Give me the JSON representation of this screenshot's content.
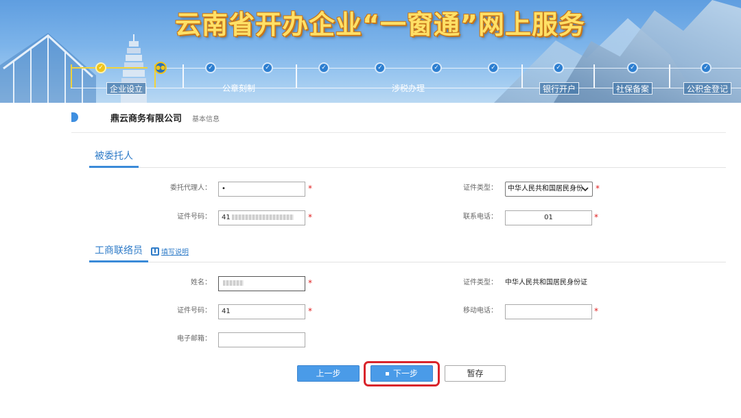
{
  "banner": {
    "title": "云南省开办企业“一窗通”网上服务"
  },
  "steps": [
    {
      "label": "企业设立"
    },
    {
      "label": "公章刻制"
    },
    {
      "label": "涉税办理"
    },
    {
      "label": "银行开户"
    },
    {
      "label": "社保备案"
    },
    {
      "label": "公积金登记"
    }
  ],
  "company": {
    "name": "鼎云商务有限公司",
    "sub": "基本信息"
  },
  "agent_section": {
    "title": "被委托人",
    "name_label": "委托代理人：",
    "name_value": "•",
    "id_type_label": "证件类型：",
    "id_type_value": "中华人民共和国居民身份",
    "id_no_label": "证件号码：",
    "id_no_value": "41",
    "phone_label": "联系电话：",
    "phone_value": "01"
  },
  "liaison_section": {
    "title": "工商联络员",
    "help_link": "填写说明",
    "name_label": "姓名：",
    "id_type_label": "证件类型：",
    "id_type_value": "中华人民共和国居民身份证",
    "id_no_label": "证件号码：",
    "id_no_value": "41",
    "mobile_label": "移动电话：",
    "mobile_value": "",
    "email_label": "电子邮箱：",
    "email_value": ""
  },
  "buttons": {
    "prev": "上一步",
    "next": "下一步",
    "save": "暂存"
  },
  "required_mark": "*"
}
